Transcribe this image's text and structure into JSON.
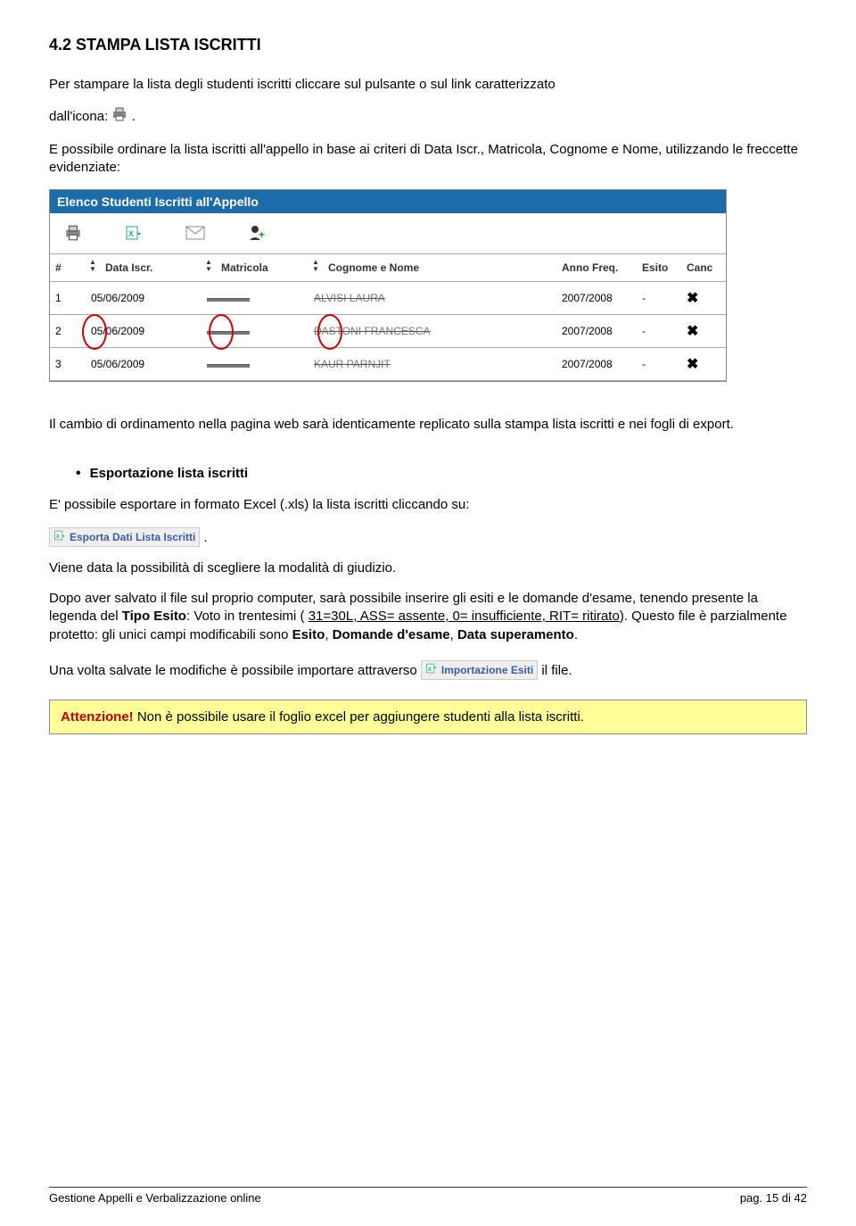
{
  "section_title": "4.2 STAMPA LISTA ISCRITTI",
  "intro1": "Per stampare la lista degli studenti iscritti cliccare sul pulsante o sul link caratterizzato",
  "intro2_prefix": "dall'icona: ",
  "intro2_suffix": ".",
  "intro3": "E possibile ordinare la lista iscritti all'appello in base ai criteri di Data Iscr., Matricola, Cognome e Nome, utilizzando le freccette evidenziate:",
  "screenshot": {
    "header": "Elenco Studenti Iscritti all'Appello",
    "cols": {
      "num": "#",
      "data_iscr": "Data Iscr.",
      "matricola": "Matricola",
      "cognome": "Cognome e Nome",
      "anno": "Anno Freq.",
      "esito": "Esito",
      "canc": "Canc"
    },
    "rows": [
      {
        "n": "1",
        "data": "05/06/2009",
        "mat": "▬▬▬▬",
        "nome": "ALVISI LAURA",
        "anno": "2007/2008",
        "esito": "-"
      },
      {
        "n": "2",
        "data": "05/06/2009",
        "mat": "▬▬▬▬",
        "nome": "DASTONI FRANCESCA",
        "anno": "2007/2008",
        "esito": "-"
      },
      {
        "n": "3",
        "data": "05/06/2009",
        "mat": "▬▬▬▬",
        "nome": "KAUR PARNJIT",
        "anno": "2007/2008",
        "esito": "-"
      }
    ]
  },
  "after_ss": "Il cambio di ordinamento nella pagina web sarà identicamente replicato sulla stampa lista iscritti e nei fogli di export.",
  "export_heading": "Esportazione lista iscritti",
  "export_p1": "E' possibile esportare in formato Excel (.xls) la lista iscritti cliccando su:",
  "export_link_label": "Esporta Dati Lista Iscritti",
  "export_p2": "Viene data la possibilità di scegliere la modalità di giudizio.",
  "export_p3a": "Dopo aver salvato il file sul proprio computer, sarà possibile inserire gli esiti e le domande d'esame, tenendo presente la legenda del ",
  "export_bold1": "Tipo Esito",
  "export_p3b": ": Voto in trentesimi ( ",
  "export_u1": "31=30L, ASS= assente, 0= insufficiente, RIT= ritirato",
  "export_p3c": "). Questo file è parzialmente protetto: gli unici campi modificabili sono ",
  "export_bold2": "Esito",
  "export_p3d": ", ",
  "export_bold3": "Domande d'esame",
  "export_p3e": ", ",
  "export_bold4": "Data superamento",
  "export_p3f": ".",
  "import_p1": "Una volta salvate le modifiche è possibile importare attraverso ",
  "import_link_label": "Importazione Esiti",
  "import_p2": " il file.",
  "warn_label": "Attenzione!",
  "warn_text": " Non è possibile usare il foglio excel per aggiungere studenti alla lista iscritti.",
  "footer_left": "Gestione Appelli e Verbalizzazione online",
  "footer_right": "pag. 15 di 42"
}
